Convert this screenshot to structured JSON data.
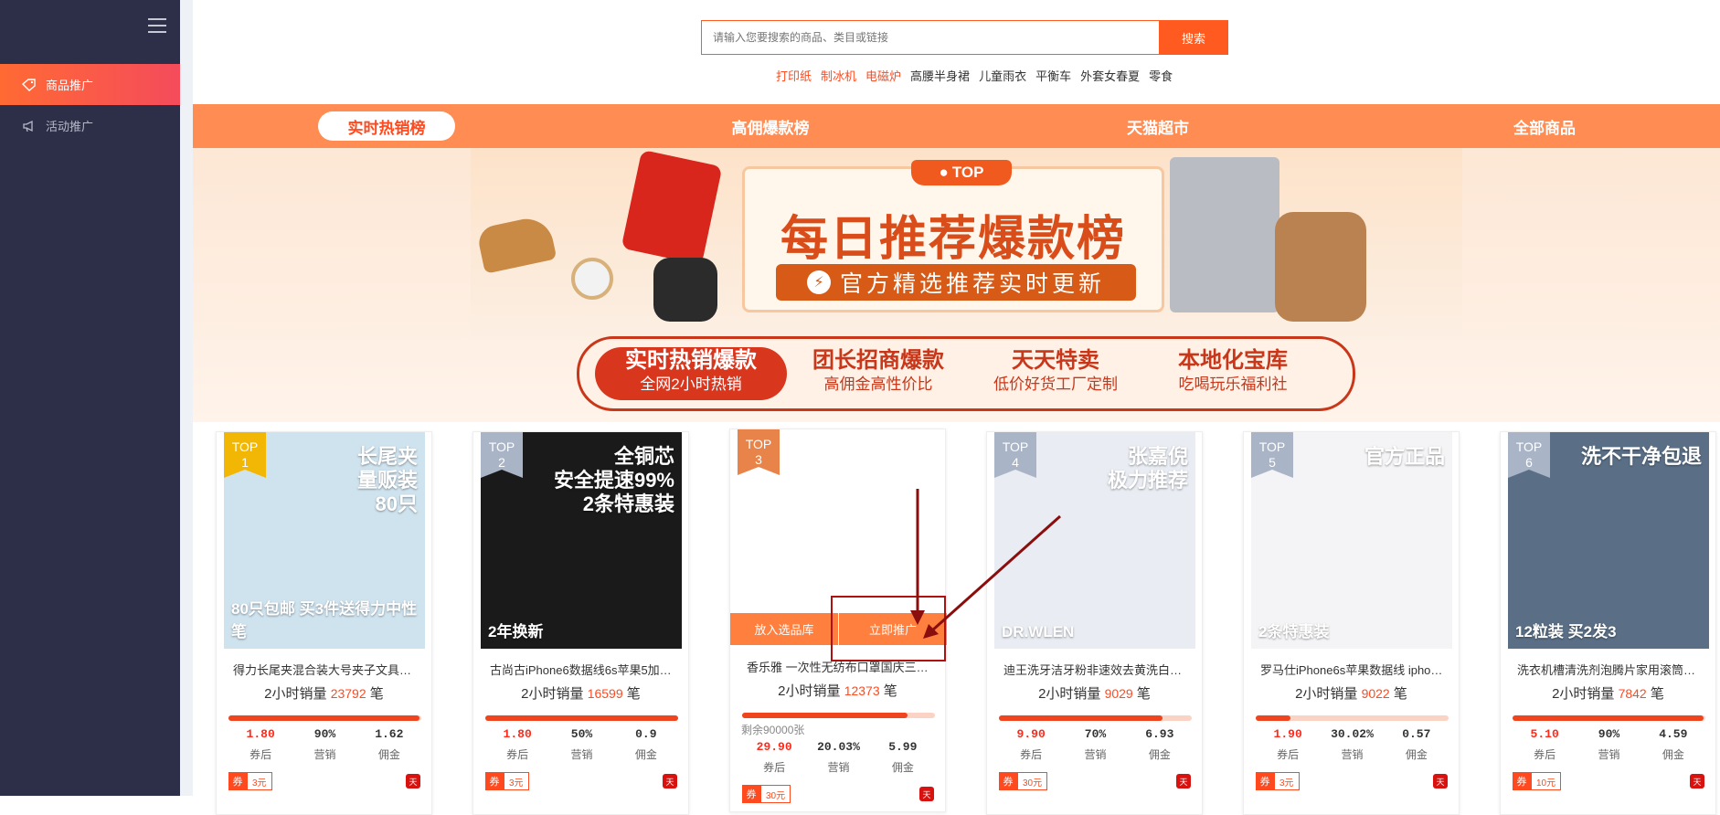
{
  "sidebar": {
    "items": [
      {
        "label": "商品推广",
        "icon": "tag-icon",
        "active": true
      },
      {
        "label": "活动推广",
        "icon": "megaphone-icon",
        "active": false
      }
    ]
  },
  "search": {
    "placeholder": "请输入您要搜索的商品、类目或链接",
    "button_label": "搜索",
    "hotwords": [
      {
        "text": "打印纸",
        "hot": true
      },
      {
        "text": "制冰机",
        "hot": true
      },
      {
        "text": "电磁炉",
        "hot": true
      },
      {
        "text": "高腰半身裙",
        "hot": false
      },
      {
        "text": "儿童雨衣",
        "hot": false
      },
      {
        "text": "平衡车",
        "hot": false
      },
      {
        "text": "外套女春夏",
        "hot": false
      },
      {
        "text": "零食",
        "hot": false
      }
    ]
  },
  "nav": {
    "tabs": [
      "实时热销榜",
      "高佣爆款榜",
      "天猫超市",
      "全部商品"
    ],
    "active_index": 0
  },
  "banner": {
    "badge": "TOP",
    "title": "每日推荐爆款榜",
    "subtitle": "官方精选推荐实时更新"
  },
  "subtabs": [
    {
      "title": "实时热销爆款",
      "desc": "全网2小时热销",
      "active": true
    },
    {
      "title": "团长招商爆款",
      "desc": "高佣金高性价比",
      "active": false
    },
    {
      "title": "天天特卖",
      "desc": "低价好货工厂定制",
      "active": false
    },
    {
      "title": "本地化宝库",
      "desc": "吃喝玩乐福利社",
      "active": false
    }
  ],
  "labels": {
    "sales_prefix": "2小时销量",
    "sales_suffix": "笔",
    "after_coupon": "券后",
    "rate": "营销",
    "commission": "佣金",
    "coupon_tag": "券",
    "add_to_pool": "放入选品库",
    "promote_now": "立即推广",
    "remaining": "剩余90000张",
    "tmall_icon": "天"
  },
  "products": [
    {
      "rank": "TOP\n1",
      "flag_color": "#f2b705",
      "title": "得力长尾夹混合装大号夹子文具小...",
      "sales": "23792",
      "progress": 0.99,
      "price": "1.80",
      "rate": "90%",
      "commission": "1.62",
      "coupon": "3元",
      "thumb_bg": "#cfe3ef",
      "thumb_main": "长尾夹\n量贩装\n80只",
      "thumb_foot": "80只包邮  买3件送得力中性笔"
    },
    {
      "rank": "TOP\n2",
      "flag_color": "#a9b4c6",
      "title": "古尚古iPhone6数据线6s苹果5加长x...",
      "sales": "16599",
      "progress": 1.0,
      "price": "1.80",
      "rate": "50%",
      "commission": "0.9",
      "coupon": "3元",
      "thumb_bg": "#1a1a1a",
      "thumb_main": "全铜芯\n安全提速99%\n2条特惠装",
      "thumb_foot": "2年换新"
    },
    {
      "rank": "TOP\n3",
      "flag_color": "#e8834a",
      "title": "香乐雅 一次性无纺布口罩国庆三层...",
      "sales": "12373",
      "progress": 0.86,
      "price": "29.90",
      "rate": "20.03%",
      "commission": "5.99",
      "coupon": "30元",
      "thumb_bg": "#ffffff",
      "thumb_main": "",
      "thumb_foot": ""
    },
    {
      "rank": "TOP\n4",
      "flag_color": "#a9b4c6",
      "title": "迪王洗牙洁牙粉非速效去黄洗白牙...",
      "sales": "9029",
      "progress": 0.85,
      "price": "9.90",
      "rate": "70%",
      "commission": "6.93",
      "coupon": "30元",
      "thumb_bg": "#e9edf3",
      "thumb_main": "张嘉倪\n极力推荐",
      "thumb_foot": "DR.WLEN"
    },
    {
      "rank": "TOP\n5",
      "flag_color": "#a9b4c6",
      "title": "罗马仕iPhone6s苹果数据线 iphone...",
      "sales": "9022",
      "progress": 0.18,
      "price": "1.90",
      "rate": "30.02%",
      "commission": "0.57",
      "coupon": "3元",
      "thumb_bg": "#f4f4f6",
      "thumb_main": "官方正品",
      "thumb_foot": "2条特惠装"
    },
    {
      "rank": "TOP\n6",
      "flag_color": "#a9b4c6",
      "title": "洗衣机槽清洗剂泡腾片家用滚筒式...",
      "sales": "7842",
      "progress": 0.99,
      "price": "5.10",
      "rate": "90%",
      "commission": "4.59",
      "coupon": "10元",
      "thumb_bg": "#5a6f86",
      "thumb_main": "洗不干净包退",
      "thumb_foot": "12粒装  买2发3"
    }
  ],
  "colors": {
    "accent": "#ff5a1f",
    "sidebar": "#2d2f48",
    "nav": "#ff8c52",
    "deep_red": "#c8371a"
  }
}
